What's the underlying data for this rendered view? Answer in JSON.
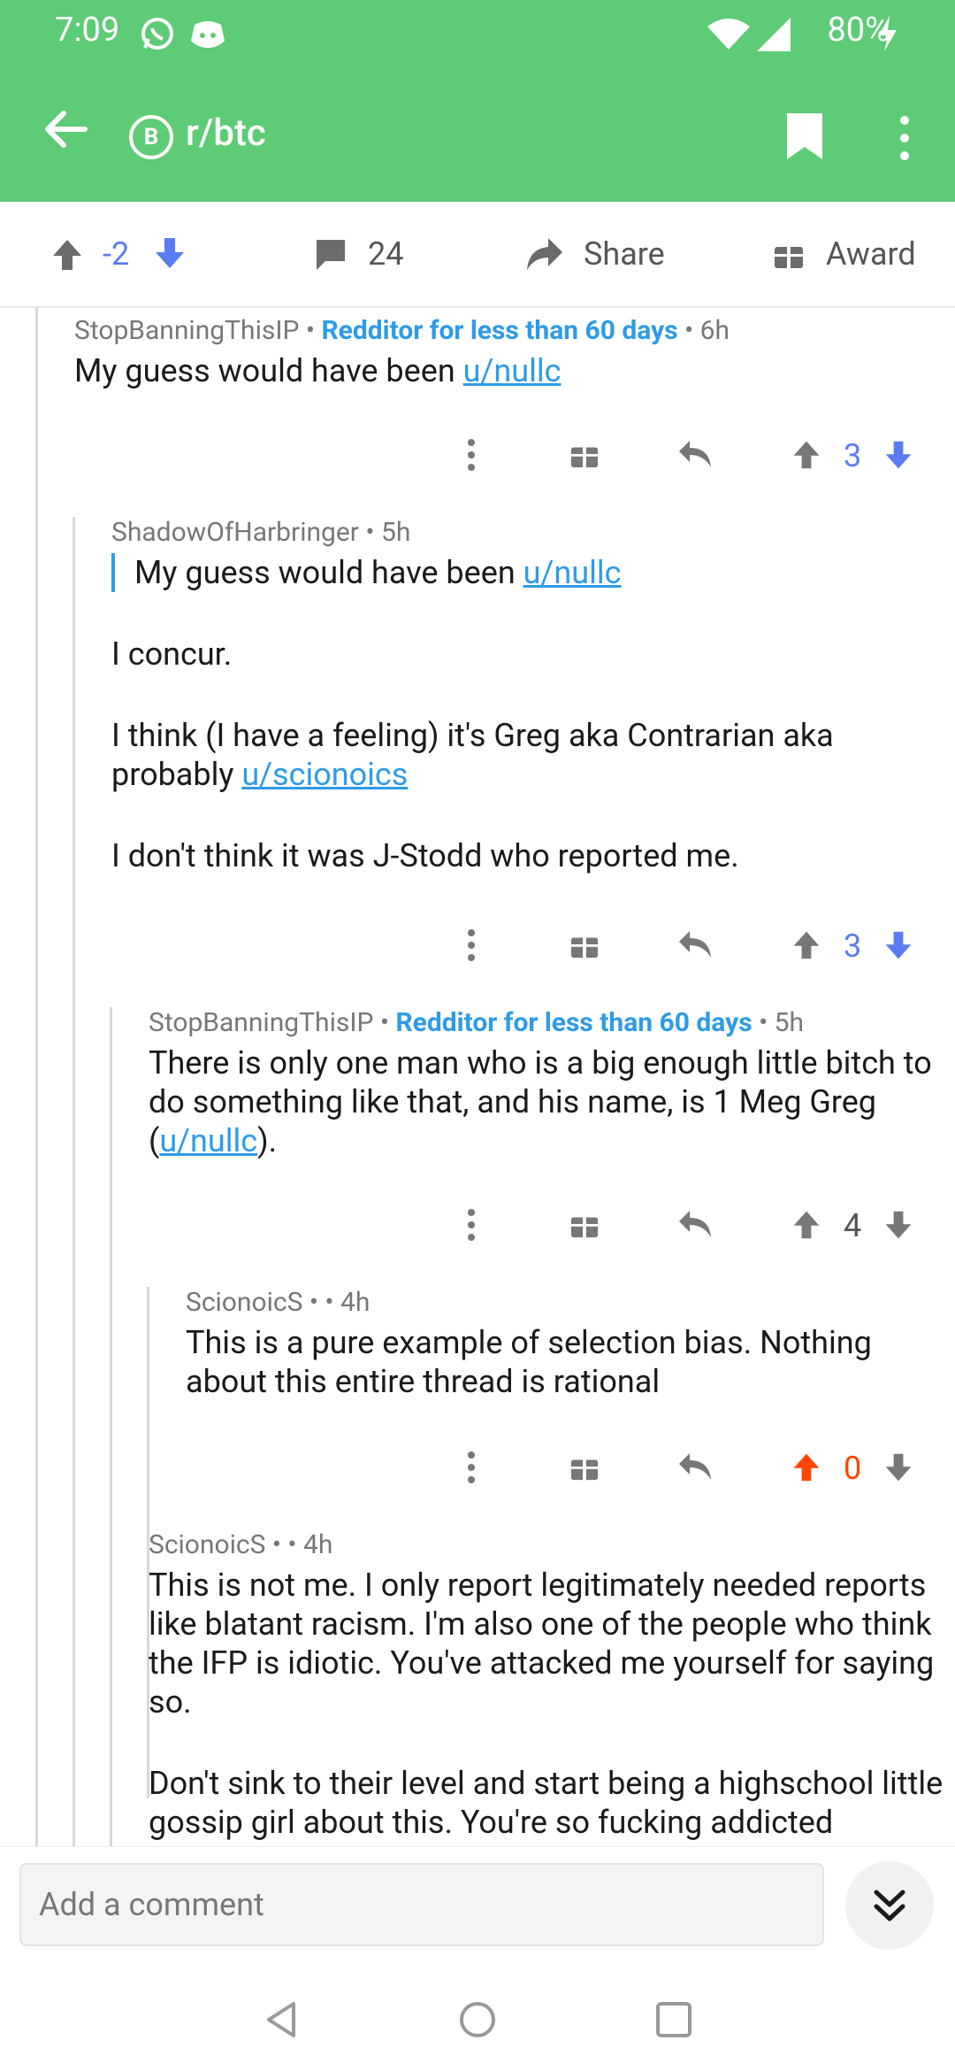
{
  "status": {
    "time": "7:09",
    "battery": "80%"
  },
  "appbar": {
    "subreddit": "r/btc",
    "sub_icon_letter": "B"
  },
  "actions": {
    "score": "-2",
    "comments": "24",
    "share": "Share",
    "award": "Award"
  },
  "comments": [
    {
      "author": "StopBanningThisIP",
      "flair": "Redditor for less than 60 days",
      "age": "6h",
      "text_before_link": "My guess would have been ",
      "link": "u/nullc",
      "score": "3"
    },
    {
      "author": "ShadowOfHarbringer",
      "age": "5h",
      "quote_before_link": "My guess would have been ",
      "quote_link": "u/nullc",
      "p1": "I concur.",
      "p2_text": "I think (I have a feeling) it's Greg aka Contrarian aka probably ",
      "p2_link": "u/scionoics",
      "p3": "I don't think it was J-Stodd who reported me.",
      "score": "3"
    },
    {
      "author": "StopBanningThisIP",
      "flair": "Redditor for less than 60 days",
      "age": "5h",
      "text": "There is only one man who is a big enough little bitch to do something like that, and his name, is 1 Meg Greg (",
      "link": "u/nullc",
      "text_after": ").",
      "score": "4"
    },
    {
      "author": "ScionoicS",
      "age": "4h",
      "text": "This is a pure example of selection bias.  Nothing about this entire thread is rational",
      "score": "0"
    },
    {
      "author": "ScionoicS",
      "age": "4h",
      "p1": "This is not me.  I only report legitimately needed reports like blatant racism.  I'm also one of the people who think the IFP is idiotic.  You've attacked me yourself for saying so.",
      "p2": "Don't sink to their level and start being a highschool little gossip girl about this.  You're so fucking addicted"
    }
  ],
  "composer": {
    "placeholder": "Add a comment"
  },
  "colors": {
    "header_green": "#5ecb76",
    "link_blue": "#2e9be6",
    "vote_blue": "#5a7cf2",
    "upvote_orange": "#ff4500"
  }
}
